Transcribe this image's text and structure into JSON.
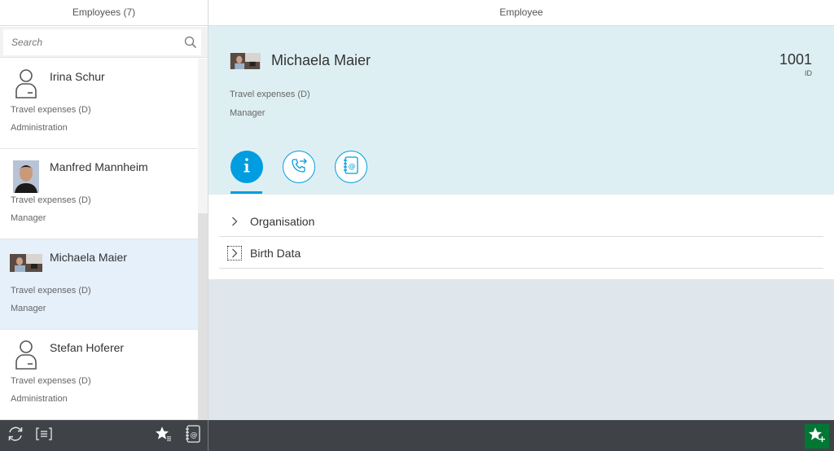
{
  "master": {
    "title": "Employees (7)",
    "search": {
      "placeholder": "Search",
      "value": ""
    },
    "items": [
      {
        "name": "Irina Schur",
        "line1": "Travel expenses (D)",
        "line2": "Administration",
        "avatar": "person-icon",
        "selected": false
      },
      {
        "name": "Manfred Mannheim",
        "line1": "Travel expenses (D)",
        "line2": "Manager",
        "avatar": "photo",
        "selected": false
      },
      {
        "name": "Michaela Maier",
        "line1": "Travel expenses (D)",
        "line2": "Manager",
        "avatar": "photo",
        "selected": true
      },
      {
        "name": "Stefan Hoferer",
        "line1": "Travel expenses (D)",
        "line2": "Administration",
        "avatar": "person-icon",
        "selected": false
      }
    ],
    "footer": {
      "buttons": [
        "refresh-icon",
        "list-icon",
        "favorite-list-icon",
        "address-book-icon"
      ]
    }
  },
  "detail": {
    "title": "Employee",
    "header": {
      "name": "Michaela Maier",
      "number": "1001",
      "number_unit": "ID",
      "attribute1": "Travel expenses (D)",
      "attribute2": "Manager"
    },
    "tabs": [
      {
        "icon": "info-icon",
        "active": true
      },
      {
        "icon": "phone-forward-icon",
        "active": false
      },
      {
        "icon": "address-book-icon",
        "active": false
      }
    ],
    "panels": [
      {
        "label": "Organisation",
        "expanded": false
      },
      {
        "label": "Birth Data",
        "expanded": false
      }
    ],
    "footer": {
      "buttons": [
        "add-favorite-icon"
      ]
    }
  },
  "colors": {
    "accent": "#009de0",
    "selected_row": "#e5f0fa",
    "object_header_bg": "#deeff3",
    "footer_bg": "#3f4348",
    "accept_green": "#007833"
  }
}
